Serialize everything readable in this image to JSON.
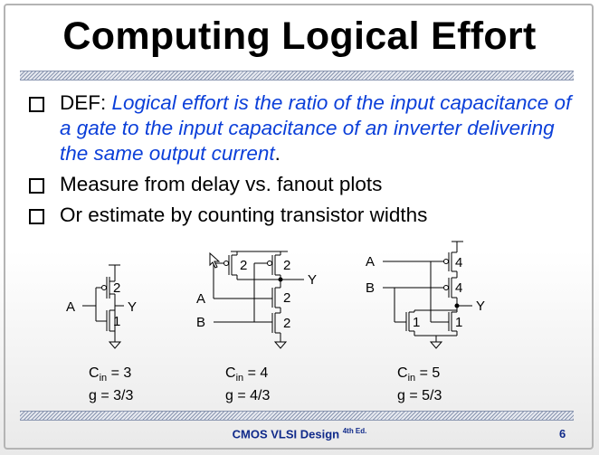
{
  "title": "Computing Logical Effort",
  "bullets": [
    {
      "prefix": "DEF: ",
      "italic": "Logical effort is the ratio of the input capacitance of a gate to the input capacitance of an inverter delivering the same output current",
      "suffix": "."
    },
    {
      "text": "Measure from delay vs. fanout plots"
    },
    {
      "text": "Or estimate by counting transistor widths"
    }
  ],
  "circuits": {
    "inverter": {
      "in": "A",
      "out": "Y",
      "p_width": "2",
      "n_width": "1",
      "cin_label": "C",
      "cin_sub": "in",
      "cin_value": "= 3",
      "g": "g = 3/3"
    },
    "nand": {
      "in_a": "A",
      "in_b": "B",
      "out": "Y",
      "p1": "2",
      "p2": "2",
      "n1": "2",
      "n2": "2",
      "cin_label": "C",
      "cin_sub": "in",
      "cin_value": "= 4",
      "g": "g = 4/3"
    },
    "nor": {
      "in_a": "A",
      "in_b": "B",
      "out": "Y",
      "p1": "4",
      "p2": "4",
      "n1": "1",
      "n2": "1",
      "cin_label": "C",
      "cin_sub": "in",
      "cin_value": "= 5",
      "g": "g = 5/3"
    }
  },
  "footer": {
    "text": "CMOS VLSI Design ",
    "edition": "4th Ed.",
    "page": "6"
  }
}
